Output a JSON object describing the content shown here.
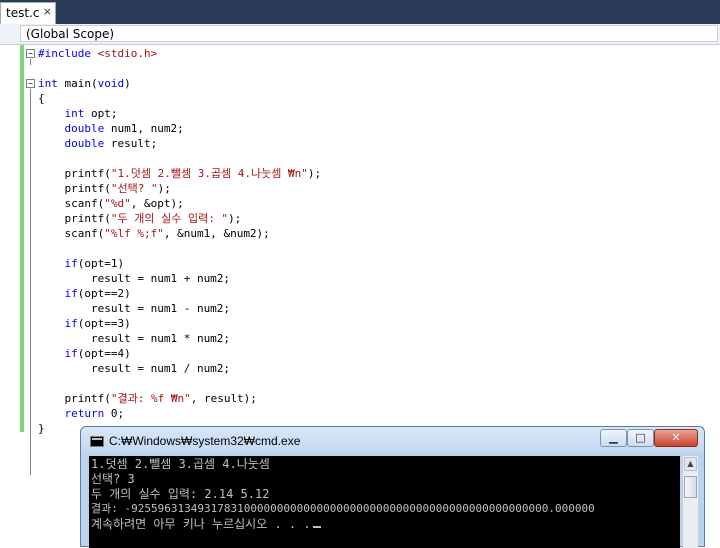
{
  "tab": {
    "label": "test.c",
    "close_glyph": "×"
  },
  "scope": {
    "value": "(Global Scope)"
  },
  "editor": {
    "fold_glyph": "−",
    "lines": [
      [
        {
          "t": "#include ",
          "c": "pp"
        },
        {
          "t": "<stdio.h>",
          "c": "str"
        }
      ],
      [],
      [
        {
          "t": "int",
          "c": "kw"
        },
        {
          "t": " main(",
          "c": ""
        },
        {
          "t": "void",
          "c": "kw"
        },
        {
          "t": ")",
          "c": ""
        }
      ],
      [
        {
          "t": "{",
          "c": ""
        }
      ],
      [
        {
          "t": "    ",
          "c": ""
        },
        {
          "t": "int",
          "c": "kw"
        },
        {
          "t": " opt;",
          "c": ""
        }
      ],
      [
        {
          "t": "    ",
          "c": ""
        },
        {
          "t": "double",
          "c": "kw"
        },
        {
          "t": " num1, num2;",
          "c": ""
        }
      ],
      [
        {
          "t": "    ",
          "c": ""
        },
        {
          "t": "double",
          "c": "kw"
        },
        {
          "t": " result;",
          "c": ""
        }
      ],
      [],
      [
        {
          "t": "    printf(",
          "c": ""
        },
        {
          "t": "\"1.덧셈 2.뺄셈 3.곱셈 4.나눗셈 ₩n\"",
          "c": "str"
        },
        {
          "t": ");",
          "c": ""
        }
      ],
      [
        {
          "t": "    printf(",
          "c": ""
        },
        {
          "t": "\"선택? \"",
          "c": "str"
        },
        {
          "t": ");",
          "c": ""
        }
      ],
      [
        {
          "t": "    scanf(",
          "c": ""
        },
        {
          "t": "\"%d\"",
          "c": "str"
        },
        {
          "t": ", &opt);",
          "c": ""
        }
      ],
      [
        {
          "t": "    printf(",
          "c": ""
        },
        {
          "t": "\"두 개의 실수 입력: \"",
          "c": "str"
        },
        {
          "t": ");",
          "c": ""
        }
      ],
      [
        {
          "t": "    scanf(",
          "c": ""
        },
        {
          "t": "\"%lf %;f\"",
          "c": "str"
        },
        {
          "t": ", &num1, &num2);",
          "c": ""
        }
      ],
      [],
      [
        {
          "t": "    ",
          "c": ""
        },
        {
          "t": "if",
          "c": "kw"
        },
        {
          "t": "(opt=1)",
          "c": ""
        }
      ],
      [
        {
          "t": "        result = num1 + num2;",
          "c": ""
        }
      ],
      [
        {
          "t": "    ",
          "c": ""
        },
        {
          "t": "if",
          "c": "kw"
        },
        {
          "t": "(opt==2)",
          "c": ""
        }
      ],
      [
        {
          "t": "        result = num1 - num2;",
          "c": ""
        }
      ],
      [
        {
          "t": "    ",
          "c": ""
        },
        {
          "t": "if",
          "c": "kw"
        },
        {
          "t": "(opt==3)",
          "c": ""
        }
      ],
      [
        {
          "t": "        result = num1 * num2;",
          "c": ""
        }
      ],
      [
        {
          "t": "    ",
          "c": ""
        },
        {
          "t": "if",
          "c": "kw"
        },
        {
          "t": "(opt==4)",
          "c": ""
        }
      ],
      [
        {
          "t": "        result = num1 / num2;",
          "c": ""
        }
      ],
      [],
      [
        {
          "t": "    printf(",
          "c": ""
        },
        {
          "t": "\"결과: %f ₩n\"",
          "c": "str"
        },
        {
          "t": ", result);",
          "c": ""
        }
      ],
      [
        {
          "t": "    ",
          "c": ""
        },
        {
          "t": "return",
          "c": "kw"
        },
        {
          "t": " 0;",
          "c": ""
        }
      ],
      [
        {
          "t": "}",
          "c": ""
        }
      ]
    ]
  },
  "console": {
    "title": "C:₩Windows₩system32₩cmd.exe",
    "minimize_glyph": "▁",
    "maximize_glyph": "□",
    "close_glyph": "✕",
    "scroll_up_glyph": "▲",
    "lines": [
      "1.덧셈 2.뺄셈 3.곱셈 4.나눗셈",
      "선택? 3",
      "두 개의 실수 입력: 2.14 5.12",
      "결과: -925596313493178310000000000000000000000000000000000000000000000.000000",
      "계속하려면 아무 키나 누르십시오 . . ."
    ]
  },
  "colors": {
    "keyword": "#0000ff",
    "string": "#a31515",
    "change_bar": "#7ed67a",
    "console_bg": "#000000",
    "console_text": "#c0c0c0",
    "close_button": "#c9452c"
  }
}
